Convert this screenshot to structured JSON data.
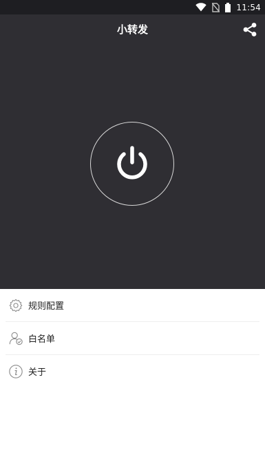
{
  "status_bar": {
    "time": "11:54",
    "icons": [
      "wifi-icon",
      "no-sim-icon",
      "battery-icon"
    ]
  },
  "app": {
    "title": "小转发",
    "share_icon": "share-icon",
    "power_icon": "power-icon"
  },
  "menu": {
    "items": [
      {
        "label": "规则配置",
        "icon": "gear-icon"
      },
      {
        "label": "白名单",
        "icon": "user-check-icon"
      },
      {
        "label": "关于",
        "icon": "info-icon"
      }
    ]
  },
  "colors": {
    "hero_background": "#2f2e33",
    "status_bar_background": "#1e1e22",
    "menu_background": "#ffffff"
  }
}
